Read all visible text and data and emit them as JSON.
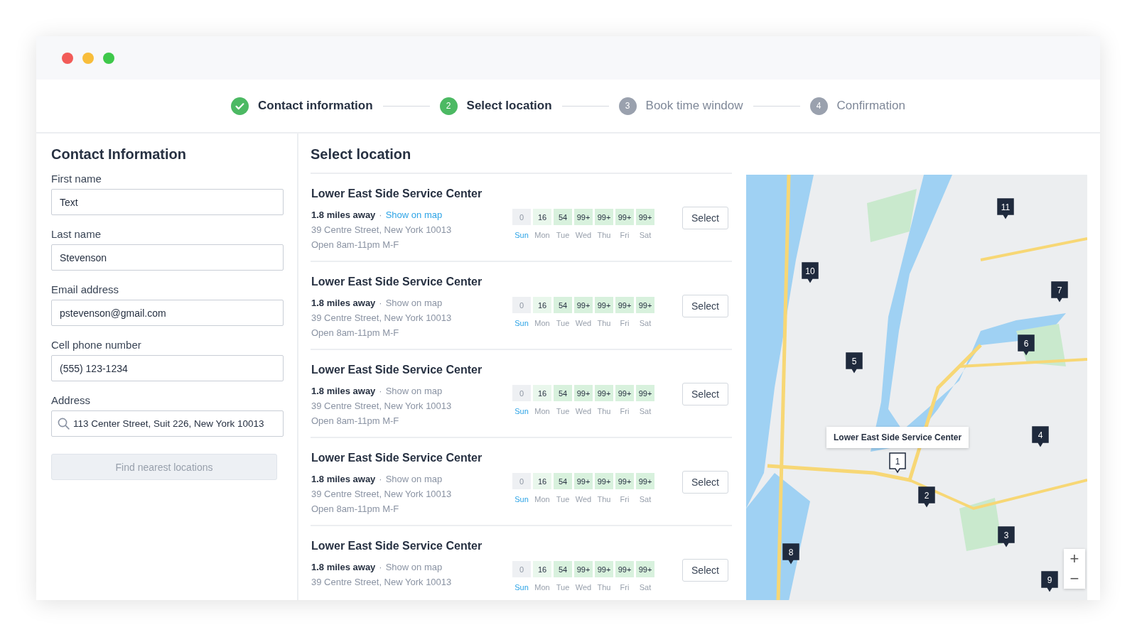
{
  "steps": [
    {
      "label": "Contact information",
      "completed": true,
      "selected": false
    },
    {
      "number": "2",
      "label": "Select location",
      "completed": false,
      "selected": true
    },
    {
      "number": "3",
      "label": "Book time window",
      "completed": false,
      "selected": false
    },
    {
      "number": "4",
      "label": "Confirmation",
      "completed": false,
      "selected": false
    }
  ],
  "contact": {
    "title": "Contact Information",
    "fields": [
      {
        "label": "First name",
        "value": "Text",
        "kind": "text"
      },
      {
        "label": "Last name",
        "value": "Stevenson",
        "kind": "text"
      },
      {
        "label": "Email address",
        "value": "pstevenson@gmail.com",
        "kind": "text"
      },
      {
        "label": "Cell phone number",
        "value": "(555) 123-1234",
        "kind": "text"
      },
      {
        "label": "Address",
        "value": "113 Center Street, Suit 226, New York 10013",
        "kind": "search"
      }
    ],
    "button": {
      "label": "Find nearest locations",
      "disabled": true
    }
  },
  "locations_panel": {
    "title": "Select location",
    "locations": [
      {
        "name": "Lower East Side Service Center",
        "distance": "1.8 miles away",
        "separator": "·",
        "map_link": {
          "label": "Show on map",
          "active": true
        },
        "address": "39 Centre Street, New York 10013",
        "hours": "Open 8am-11pm M-F",
        "select": "Select",
        "days": [
          {
            "day": "Sun",
            "count": "0",
            "color": "#eef0f3",
            "selected": true
          },
          {
            "day": "Mon",
            "count": "16",
            "color": "#e9f7ec",
            "selected": false
          },
          {
            "day": "Tue",
            "count": "54",
            "color": "#d8f1dd",
            "selected": false
          },
          {
            "day": "Wed",
            "count": "99+",
            "color": "#d8f1dd",
            "selected": false
          },
          {
            "day": "Thu",
            "count": "99+",
            "color": "#d8f1dd",
            "selected": false
          },
          {
            "day": "Fri",
            "count": "99+",
            "color": "#d8f1dd",
            "selected": false
          },
          {
            "day": "Sat",
            "count": "99+",
            "color": "#d8f1dd",
            "selected": false
          }
        ]
      },
      {
        "name": "Lower East Side Service Center",
        "distance": "1.8 miles away",
        "separator": "·",
        "map_link": {
          "label": "Show on map",
          "active": false
        },
        "address": "39 Centre Street, New York 10013",
        "hours": "Open 8am-11pm M-F",
        "select": "Select",
        "days": [
          {
            "day": "Sun",
            "count": "0",
            "color": "#eef0f3",
            "selected": true
          },
          {
            "day": "Mon",
            "count": "16",
            "color": "#e9f7ec",
            "selected": false
          },
          {
            "day": "Tue",
            "count": "54",
            "color": "#d8f1dd",
            "selected": false
          },
          {
            "day": "Wed",
            "count": "99+",
            "color": "#d8f1dd",
            "selected": false
          },
          {
            "day": "Thu",
            "count": "99+",
            "color": "#d8f1dd",
            "selected": false
          },
          {
            "day": "Fri",
            "count": "99+",
            "color": "#d8f1dd",
            "selected": false
          },
          {
            "day": "Sat",
            "count": "99+",
            "color": "#d8f1dd",
            "selected": false
          }
        ]
      },
      {
        "name": "Lower East Side Service Center",
        "distance": "1.8 miles away",
        "separator": "·",
        "map_link": {
          "label": "Show on map",
          "active": false
        },
        "address": "39 Centre Street, New York 10013",
        "hours": "Open 8am-11pm M-F",
        "select": "Select",
        "days": [
          {
            "day": "Sun",
            "count": "0",
            "color": "#eef0f3",
            "selected": true
          },
          {
            "day": "Mon",
            "count": "16",
            "color": "#e9f7ec",
            "selected": false
          },
          {
            "day": "Tue",
            "count": "54",
            "color": "#d8f1dd",
            "selected": false
          },
          {
            "day": "Wed",
            "count": "99+",
            "color": "#d8f1dd",
            "selected": false
          },
          {
            "day": "Thu",
            "count": "99+",
            "color": "#d8f1dd",
            "selected": false
          },
          {
            "day": "Fri",
            "count": "99+",
            "color": "#d8f1dd",
            "selected": false
          },
          {
            "day": "Sat",
            "count": "99+",
            "color": "#d8f1dd",
            "selected": false
          }
        ]
      },
      {
        "name": "Lower East Side Service Center",
        "distance": "1.8 miles away",
        "separator": "·",
        "map_link": {
          "label": "Show on map",
          "active": false
        },
        "address": "39 Centre Street, New York 10013",
        "hours": "Open 8am-11pm M-F",
        "select": "Select",
        "days": [
          {
            "day": "Sun",
            "count": "0",
            "color": "#eef0f3",
            "selected": true
          },
          {
            "day": "Mon",
            "count": "16",
            "color": "#e9f7ec",
            "selected": false
          },
          {
            "day": "Tue",
            "count": "54",
            "color": "#d8f1dd",
            "selected": false
          },
          {
            "day": "Wed",
            "count": "99+",
            "color": "#d8f1dd",
            "selected": false
          },
          {
            "day": "Thu",
            "count": "99+",
            "color": "#d8f1dd",
            "selected": false
          },
          {
            "day": "Fri",
            "count": "99+",
            "color": "#d8f1dd",
            "selected": false
          },
          {
            "day": "Sat",
            "count": "99+",
            "color": "#d8f1dd",
            "selected": false
          }
        ]
      },
      {
        "name": "Lower East Side Service Center",
        "distance": "1.8 miles away",
        "separator": "·",
        "map_link": {
          "label": "Show on map",
          "active": false
        },
        "address": "39 Centre Street, New York 10013",
        "select": "Select",
        "days": [
          {
            "day": "Sun",
            "count": "0",
            "color": "#eef0f3",
            "selected": true
          },
          {
            "day": "Mon",
            "count": "16",
            "color": "#e9f7ec",
            "selected": false
          },
          {
            "day": "Tue",
            "count": "54",
            "color": "#d8f1dd",
            "selected": false
          },
          {
            "day": "Wed",
            "count": "99+",
            "color": "#d8f1dd",
            "selected": false
          },
          {
            "day": "Thu",
            "count": "99+",
            "color": "#d8f1dd",
            "selected": false
          },
          {
            "day": "Fri",
            "count": "99+",
            "color": "#d8f1dd",
            "selected": false
          },
          {
            "day": "Sat",
            "count": "99+",
            "color": "#d8f1dd",
            "selected": false
          }
        ]
      }
    ]
  },
  "map": {
    "kind": "picture",
    "tooltip": "Lower East Side Service Center",
    "markers": [
      {
        "label": "11",
        "selected": false
      },
      {
        "label": "10",
        "selected": false
      },
      {
        "label": "7",
        "selected": false
      },
      {
        "label": "6",
        "selected": false
      },
      {
        "label": "5",
        "selected": false
      },
      {
        "label": "4",
        "selected": false
      },
      {
        "label": "1",
        "selected": true
      },
      {
        "label": "2",
        "selected": false
      },
      {
        "label": "3",
        "selected": false
      },
      {
        "label": "8",
        "selected": false
      },
      {
        "label": "9",
        "selected": false
      }
    ],
    "zoom_in": "+",
    "zoom_out": "−"
  }
}
